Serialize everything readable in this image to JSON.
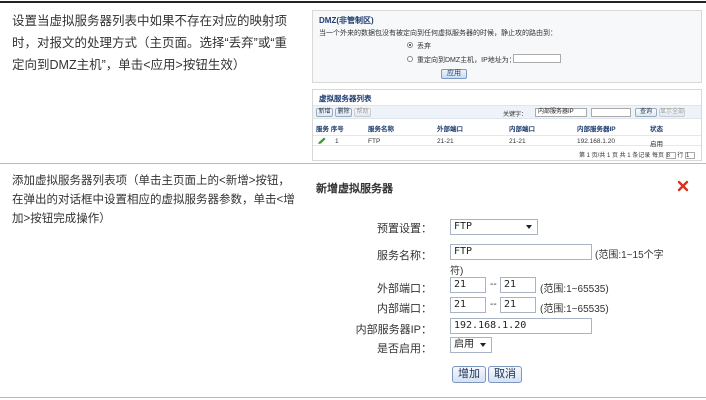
{
  "rows": [
    {
      "description": "设置当虚拟服务器列表中如果不存在对应的映射项时，对报文的处理方式（主页面。选择“丢弃”或“重定向到DMZ主机”，单击<应用>按钮生效）",
      "dmz_panel": {
        "title": "DMZ(非管制区)",
        "prompt": "当一个外来的数据包没有被定向到任何虚拟服务器的时候，静止攻的路由到：",
        "option_drop": "丢弃",
        "option_redirect": "重定向到DMZ主机，IP地址为：",
        "selected": "drop",
        "apply_label": "应用"
      },
      "vs_list": {
        "title": "虚拟服务器列表",
        "btn_add": "新增",
        "btn_delete": "删除",
        "btn_search_icon": "帮助",
        "search_label": "关键字：",
        "search_field": "内部服务器IP",
        "btn_query": "查询",
        "btn_show_all": "显示全部",
        "columns": [
          "服务 序号",
          "服务名称",
          "外部端口",
          "内部端口",
          "内部服务器IP",
          "状态"
        ],
        "row": {
          "index": "1",
          "service": "FTP",
          "ext_port": "21-21",
          "int_port": "21-21",
          "server_ip": "192.168.1.20",
          "status": "启用"
        },
        "pager": "第 1 页/共 1 页 共 1 条记录 每页",
        "page_size": "8",
        "page_label": "行",
        "page_num": "1"
      }
    },
    {
      "description": "添加虚拟服务器列表项（单击主页面上的<新增>按钮，在弹出的对话框中设置相应的虚拟服务器参数，单击<增加>按钮完成操作）",
      "dialog": {
        "title": "新增虚拟服务器",
        "preset_label": "预置设置：",
        "preset_value": "FTP",
        "name_label": "服务名称：",
        "name_value": "FTP",
        "name_hint_1": "(范围:1~15个字",
        "name_hint_2": "符)",
        "ext_label": "外部端口：",
        "ext_from": "21",
        "ext_to": "21",
        "ext_hint": "(范围:1~65535)",
        "int_label": "内部端口：",
        "int_from": "21",
        "int_to": "21",
        "int_hint": "(范围:1~65535)",
        "ip_label": "内部服务器IP：",
        "ip_value": "192.168.1.20",
        "enable_label": "是否启用：",
        "enable_value": "启用",
        "add_label": "增加",
        "cancel_label": "取消"
      }
    }
  ]
}
